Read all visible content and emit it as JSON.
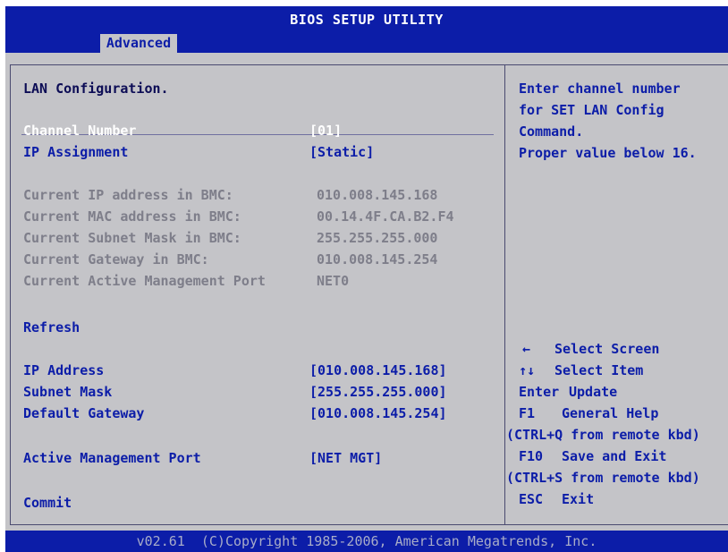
{
  "title": "BIOS SETUP UTILITY",
  "active_tab": "Advanced",
  "section_title": "LAN Configuration.",
  "channel_number": {
    "label": "Channel Number",
    "value": "[01]"
  },
  "ip_assignment": {
    "label": "IP Assignment",
    "value": "[Static]"
  },
  "bmc_info": [
    {
      "label": "Current IP address in BMC:",
      "value": "010.008.145.168"
    },
    {
      "label": "Current MAC address in BMC:",
      "value": "00.14.4F.CA.B2.F4"
    },
    {
      "label": "Current Subnet Mask in BMC:",
      "value": "255.255.255.000"
    },
    {
      "label": "Current Gateway in BMC:",
      "value": "010.008.145.254"
    },
    {
      "label": "Current Active Management Port",
      "value": "NET0"
    }
  ],
  "refresh_label": "Refresh",
  "network_fields": [
    {
      "label": "IP Address",
      "value": "[010.008.145.168]"
    },
    {
      "label": "Subnet Mask",
      "value": "[255.255.255.000]"
    },
    {
      "label": "Default Gateway",
      "value": "[010.008.145.254]"
    }
  ],
  "active_mgmt_port": {
    "label": "Active Management Port",
    "value": "[NET MGT]"
  },
  "commit_label": "Commit",
  "help_text": [
    "Enter channel number",
    "for SET LAN Config",
    "Command.",
    "Proper value below 16."
  ],
  "key_help": [
    {
      "key": "←",
      "action": "Select Screen"
    },
    {
      "key": "↑↓",
      "action": "Select Item"
    },
    {
      "key": "Enter",
      "action": "Update"
    },
    {
      "key": "F1",
      "action": "General Help"
    },
    {
      "note": "(CTRL+Q from remote kbd)"
    },
    {
      "key": "F10",
      "action": "Save and Exit"
    },
    {
      "note": "(CTRL+S from remote kbd)"
    },
    {
      "key": "ESC",
      "action": "Exit"
    }
  ],
  "footer": "v02.61  (C)Copyright 1985-2006, American Megatrends, Inc.",
  "colors": {
    "bios_blue": "#0c1da8",
    "panel_gray": "#c4c4c8",
    "selected_text": "#ffffff",
    "readonly_text": "#7e7e8a"
  }
}
